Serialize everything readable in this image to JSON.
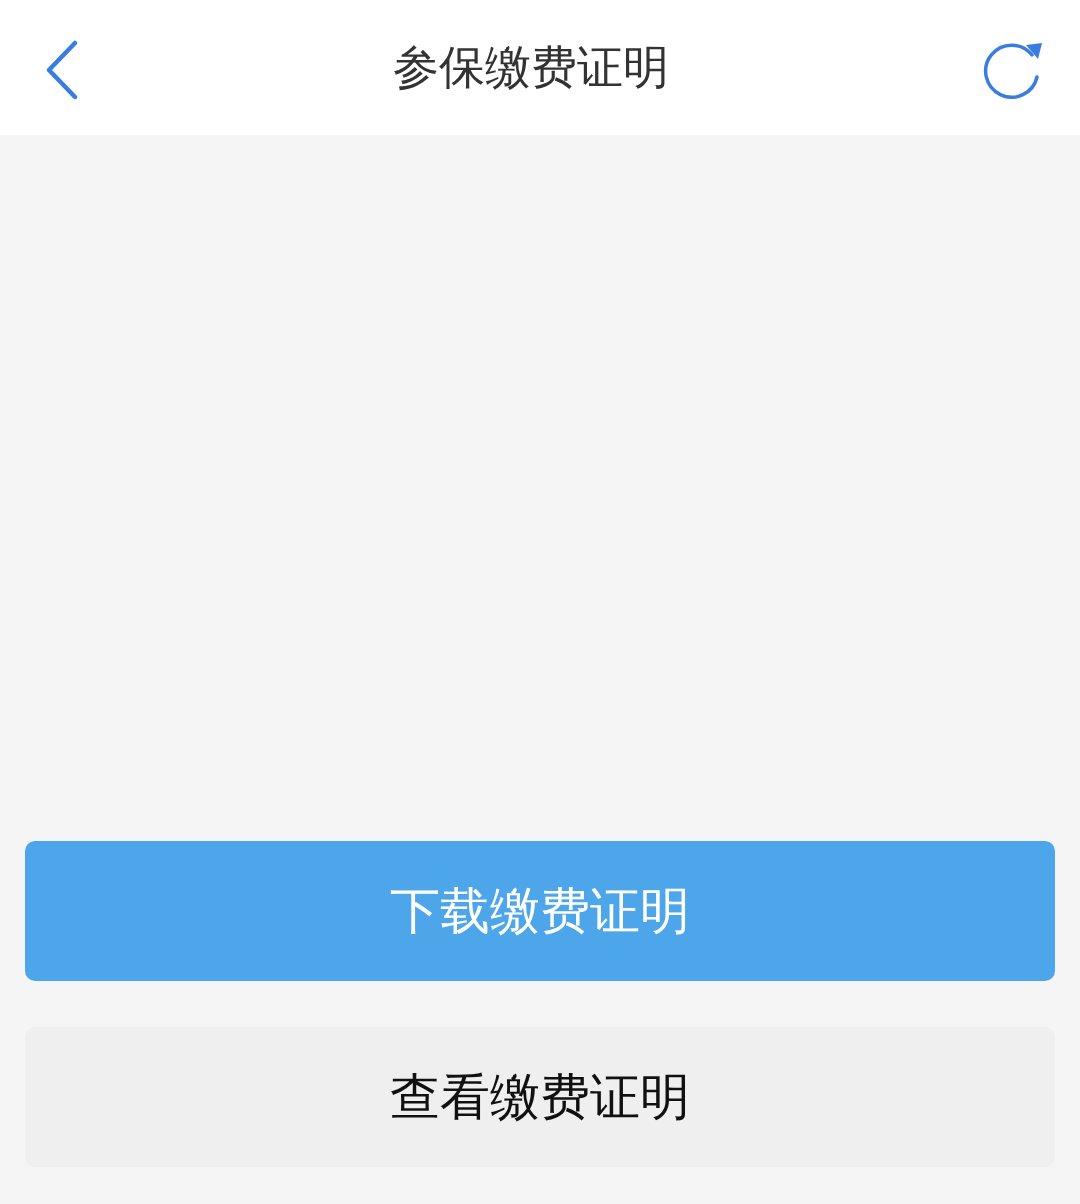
{
  "header": {
    "title": "参保缴费证明"
  },
  "buttons": [
    {
      "label": "下载缴费证明",
      "kind": "primary"
    },
    {
      "label": "查看缴费证明",
      "kind": "secondary"
    }
  ]
}
